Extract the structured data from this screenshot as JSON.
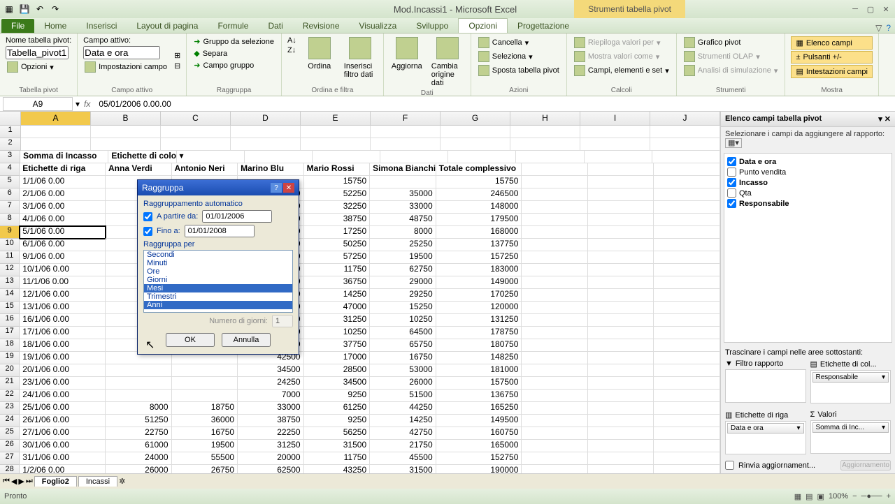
{
  "app": {
    "title": "Mod.Incassi1 - Microsoft Excel",
    "context_tab": "Strumenti tabella pivot"
  },
  "tabs": {
    "file": "File",
    "home": "Home",
    "insert": "Inserisci",
    "layout": "Layout di pagina",
    "formule": "Formule",
    "dati": "Dati",
    "rev": "Revisione",
    "vis": "Visualizza",
    "svil": "Sviluppo",
    "opz": "Opzioni",
    "prog": "Progettazione"
  },
  "ribbon": {
    "g1": {
      "name_lbl": "Nome tabella pivot:",
      "name_val": "Tabella_pivot1",
      "opts": "Opzioni",
      "label": "Tabella pivot"
    },
    "g2": {
      "field_lbl": "Campo attivo:",
      "field_val": "Data e ora",
      "settings": "Impostazioni campo",
      "label": "Campo attivo"
    },
    "g3": {
      "a": "Gruppo da selezione",
      "b": "Separa",
      "c": "Campo gruppo",
      "label": "Raggruppa"
    },
    "g4": {
      "sort": "Ordina",
      "slicer": "Inserisci filtro dati",
      "label": "Ordina e filtra"
    },
    "g5": {
      "refresh": "Aggiorna",
      "src": "Cambia origine dati",
      "label": "Dati"
    },
    "g6": {
      "clear": "Cancella",
      "select": "Seleziona",
      "move": "Sposta tabella pivot",
      "label": "Azioni"
    },
    "g7": {
      "a": "Riepiloga valori per",
      "b": "Mostra valori come",
      "c": "Campi, elementi e set",
      "label": "Calcoli"
    },
    "g8": {
      "a": "Grafico pivot",
      "b": "Strumenti OLAP",
      "c": "Analisi di simulazione",
      "label": "Strumenti"
    },
    "g9": {
      "a": "Elenco campi",
      "b": "Pulsanti +/-",
      "c": "Intestazioni campi",
      "label": "Mostra"
    }
  },
  "namebox": "A9",
  "formula": "05/01/2006  0.00.00",
  "columns": [
    "A",
    "B",
    "C",
    "D",
    "E",
    "F",
    "G",
    "H",
    "I",
    "J"
  ],
  "pivot": {
    "sum_label": "Somma di Incasso",
    "col_label": "Etichette di colonna",
    "row_label": "Etichette di riga",
    "headers": [
      "Anna Verdi",
      "Antonio Neri",
      "Marino Blu",
      "Mario Rossi",
      "Simona Bianchi",
      "Totale complessivo"
    ]
  },
  "rows": [
    {
      "d": "1/1/06 0.00",
      "v": [
        "",
        "",
        "",
        "15750",
        "",
        "15750"
      ]
    },
    {
      "d": "2/1/06 0.00",
      "v": [
        "",
        "",
        "44000",
        "52250",
        "35000",
        "246500"
      ]
    },
    {
      "d": "3/1/06 0.00",
      "v": [
        "",
        "",
        "21250",
        "32250",
        "33000",
        "148000"
      ]
    },
    {
      "d": "4/1/06 0.00",
      "v": [
        "",
        "",
        "39750",
        "38750",
        "48750",
        "179500"
      ]
    },
    {
      "d": "5/1/06 0.00",
      "v": [
        "",
        "",
        "54250",
        "17250",
        "8000",
        "168000"
      ]
    },
    {
      "d": "6/1/06 0.00",
      "v": [
        "",
        "",
        "20750",
        "50250",
        "25250",
        "137750"
      ]
    },
    {
      "d": "9/1/06 0.00",
      "v": [
        "",
        "",
        "42750",
        "57250",
        "19500",
        "157250"
      ]
    },
    {
      "d": "10/1/06 0.00",
      "v": [
        "",
        "",
        "23500",
        "11750",
        "62750",
        "183000"
      ]
    },
    {
      "d": "11/1/06 0.00",
      "v": [
        "",
        "",
        "31500",
        "36750",
        "29000",
        "149000"
      ]
    },
    {
      "d": "12/1/06 0.00",
      "v": [
        "",
        "",
        "29250",
        "14250",
        "29250",
        "170250"
      ]
    },
    {
      "d": "13/1/06 0.00",
      "v": [
        "",
        "",
        "16500",
        "47000",
        "15250",
        "120000"
      ]
    },
    {
      "d": "16/1/06 0.00",
      "v": [
        "",
        "",
        "33000",
        "31250",
        "10250",
        "131250"
      ]
    },
    {
      "d": "17/1/06 0.00",
      "v": [
        "",
        "",
        "15750",
        "10250",
        "64500",
        "178750"
      ]
    },
    {
      "d": "18/1/06 0.00",
      "v": [
        "",
        "",
        "48250",
        "37750",
        "65750",
        "180750"
      ]
    },
    {
      "d": "19/1/06 0.00",
      "v": [
        "",
        "",
        "42500",
        "17000",
        "16750",
        "148250"
      ]
    },
    {
      "d": "20/1/06 0.00",
      "v": [
        "",
        "",
        "34500",
        "28500",
        "53000",
        "181000"
      ]
    },
    {
      "d": "23/1/06 0.00",
      "v": [
        "",
        "",
        "24250",
        "34500",
        "26000",
        "157500"
      ]
    },
    {
      "d": "24/1/06 0.00",
      "v": [
        "",
        "",
        "7000",
        "9250",
        "51500",
        "136750"
      ]
    },
    {
      "d": "25/1/06 0.00",
      "v": [
        "8000",
        "18750",
        "33000",
        "61250",
        "44250",
        "165250"
      ]
    },
    {
      "d": "26/1/06 0.00",
      "v": [
        "51250",
        "36000",
        "38750",
        "9250",
        "14250",
        "149500"
      ]
    },
    {
      "d": "27/1/06 0.00",
      "v": [
        "22750",
        "16750",
        "22250",
        "56250",
        "42750",
        "160750"
      ]
    },
    {
      "d": "30/1/06 0.00",
      "v": [
        "61000",
        "19500",
        "31250",
        "31500",
        "21750",
        "165000"
      ]
    },
    {
      "d": "31/1/06 0.00",
      "v": [
        "24000",
        "55500",
        "20000",
        "11750",
        "45500",
        "152750"
      ]
    },
    {
      "d": "1/2/06 0.00",
      "v": [
        "26000",
        "26750",
        "62500",
        "43250",
        "31500",
        "190000"
      ]
    }
  ],
  "dialog": {
    "title": "Raggruppa",
    "auto": "Raggruppamento automatico",
    "start": "A partire da:",
    "start_val": "01/01/2006",
    "end": "Fino a:",
    "end_val": "01/01/2008",
    "by": "Raggruppa per",
    "items": [
      "Secondi",
      "Minuti",
      "Ore",
      "Giorni",
      "Mesi",
      "Trimestri",
      "Anni"
    ],
    "days": "Numero di giorni:",
    "days_val": "1",
    "ok": "OK",
    "cancel": "Annulla"
  },
  "fieldlist": {
    "title": "Elenco campi tabella pivot",
    "note": "Selezionare i campi da aggiungere al rapporto:",
    "fields": [
      {
        "name": "Data e ora",
        "checked": true
      },
      {
        "name": "Punto vendita",
        "checked": false
      },
      {
        "name": "Incasso",
        "checked": true
      },
      {
        "name": "Qta",
        "checked": false
      },
      {
        "name": "Responsabile",
        "checked": true
      }
    ],
    "drag": "Trascinare i campi nelle aree sottostanti:",
    "filter": "Filtro rapporto",
    "cols": "Etichette di col...",
    "rowsl": "Etichette di riga",
    "vals": "Valori",
    "col_pill": "Responsabile",
    "row_pill": "Data e ora",
    "val_pill": "Somma di Inc...",
    "defer": "Rinvia aggiornament...",
    "update": "Aggiornamento"
  },
  "sheets": {
    "s1": "Foglio2",
    "s2": "Incassi"
  },
  "status": {
    "ready": "Pronto",
    "zoom": "100%"
  }
}
